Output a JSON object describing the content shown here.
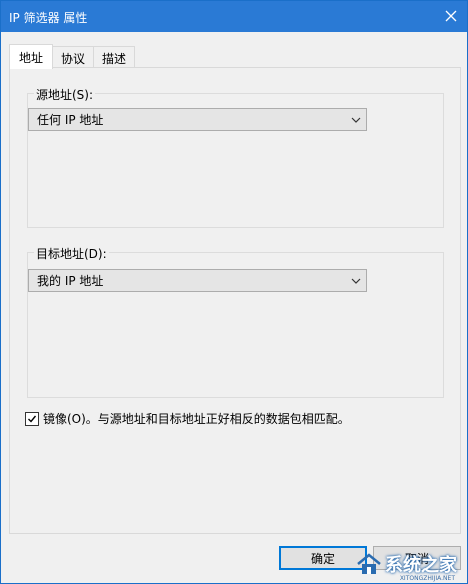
{
  "window": {
    "title": "IP 筛选器 属性"
  },
  "tabs": [
    {
      "label": "地址",
      "active": true
    },
    {
      "label": "协议",
      "active": false
    },
    {
      "label": "描述",
      "active": false
    }
  ],
  "source": {
    "label": "源地址(S):",
    "selected": "任何 IP 地址"
  },
  "destination": {
    "label": "目标地址(D):",
    "selected": "我的 IP 地址"
  },
  "mirror": {
    "checked": true,
    "label": "镜像(O)。与源地址和目标地址正好相反的数据包相匹配。"
  },
  "buttons": {
    "ok": "确定",
    "cancel": "取消"
  },
  "watermark": {
    "text": "系统之家",
    "sub": "XITONGZHIJIA.NET"
  },
  "colors": {
    "titlebar": "#2a7ad5",
    "accent": "#0078d7"
  }
}
